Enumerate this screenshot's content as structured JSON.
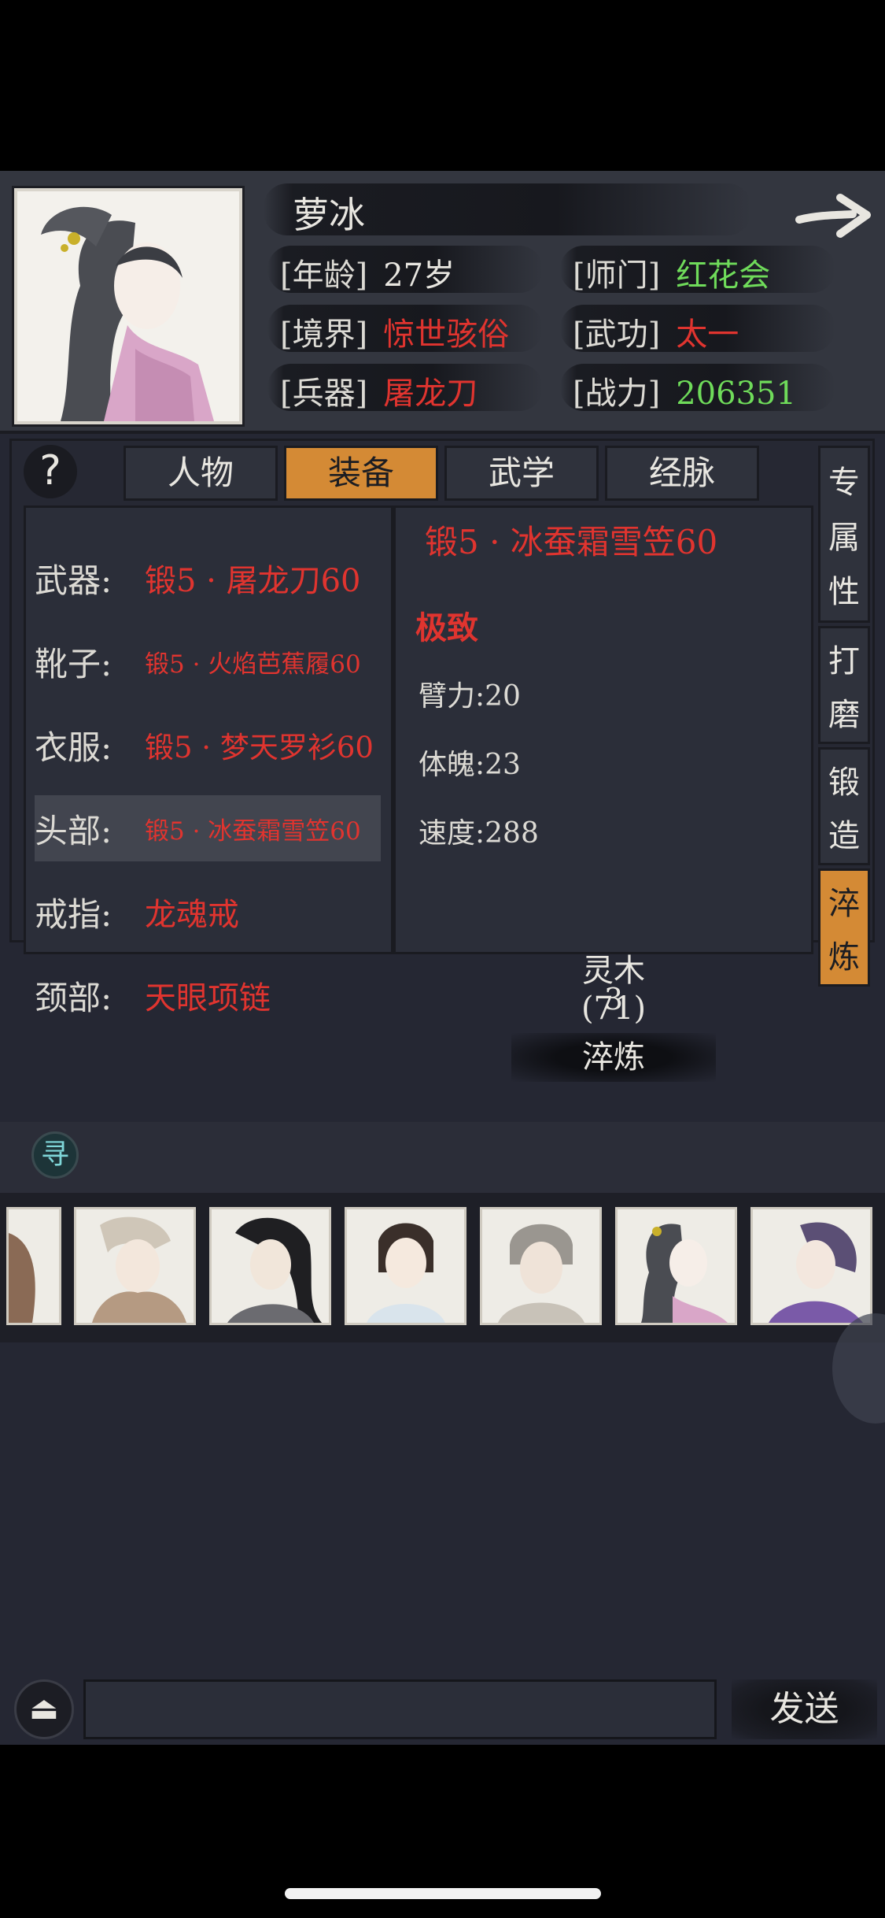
{
  "character": {
    "name": "萝冰",
    "stats": {
      "age": {
        "label": "[年龄]",
        "value": "27岁"
      },
      "sect": {
        "label": "[师门]",
        "value": "红花会"
      },
      "realm": {
        "label": "[境界]",
        "value": "惊世骇俗"
      },
      "skill": {
        "label": "[武功]",
        "value": "太一"
      },
      "weapon": {
        "label": "[兵器]",
        "value": "屠龙刀"
      },
      "power": {
        "label": "[战力]",
        "value": "206351"
      }
    }
  },
  "tabs": [
    "人物",
    "装备",
    "武学",
    "经脉"
  ],
  "active_tab": "装备",
  "help_icon": "?",
  "side_tabs": [
    {
      "chars": [
        "专",
        "属",
        "性"
      ]
    },
    {
      "chars": [
        "打",
        "磨"
      ]
    },
    {
      "chars": [
        "锻",
        "造"
      ]
    },
    {
      "chars": [
        "淬",
        "炼"
      ]
    }
  ],
  "slots": [
    {
      "label": "武器:",
      "value": "锻5 · 屠龙刀60"
    },
    {
      "label": "靴子:",
      "value": "锻5 · 火焰芭蕉履60"
    },
    {
      "label": "衣服:",
      "value": "锻5 · 梦天罗衫60"
    },
    {
      "label": "头部:",
      "value": "锻5 · 冰蚕霜雪笠60"
    },
    {
      "label": "戒指:",
      "value": "龙魂戒"
    },
    {
      "label": "颈部:",
      "value": "天眼项链"
    }
  ],
  "detail": {
    "title": "锻5 · 冰蚕霜雪笠60",
    "quality": "极致",
    "attributes": [
      "臂力:20",
      "体魄:23",
      "速度:288"
    ],
    "material_name": "灵木(71)",
    "material_count": "3",
    "action_label": "淬炼"
  },
  "search_icon_glyph": "寻",
  "chat": {
    "toggle_glyph": "⏏",
    "input_value": "",
    "send_label": "发送"
  },
  "colors": {
    "accent_orange": "#d48a35",
    "rarity_red": "#e0342f",
    "value_green": "#6fdb5a",
    "panel_bg": "#252733"
  },
  "icons": [
    "arrow-right-icon",
    "help-icon",
    "search-icon",
    "eject-icon"
  ]
}
